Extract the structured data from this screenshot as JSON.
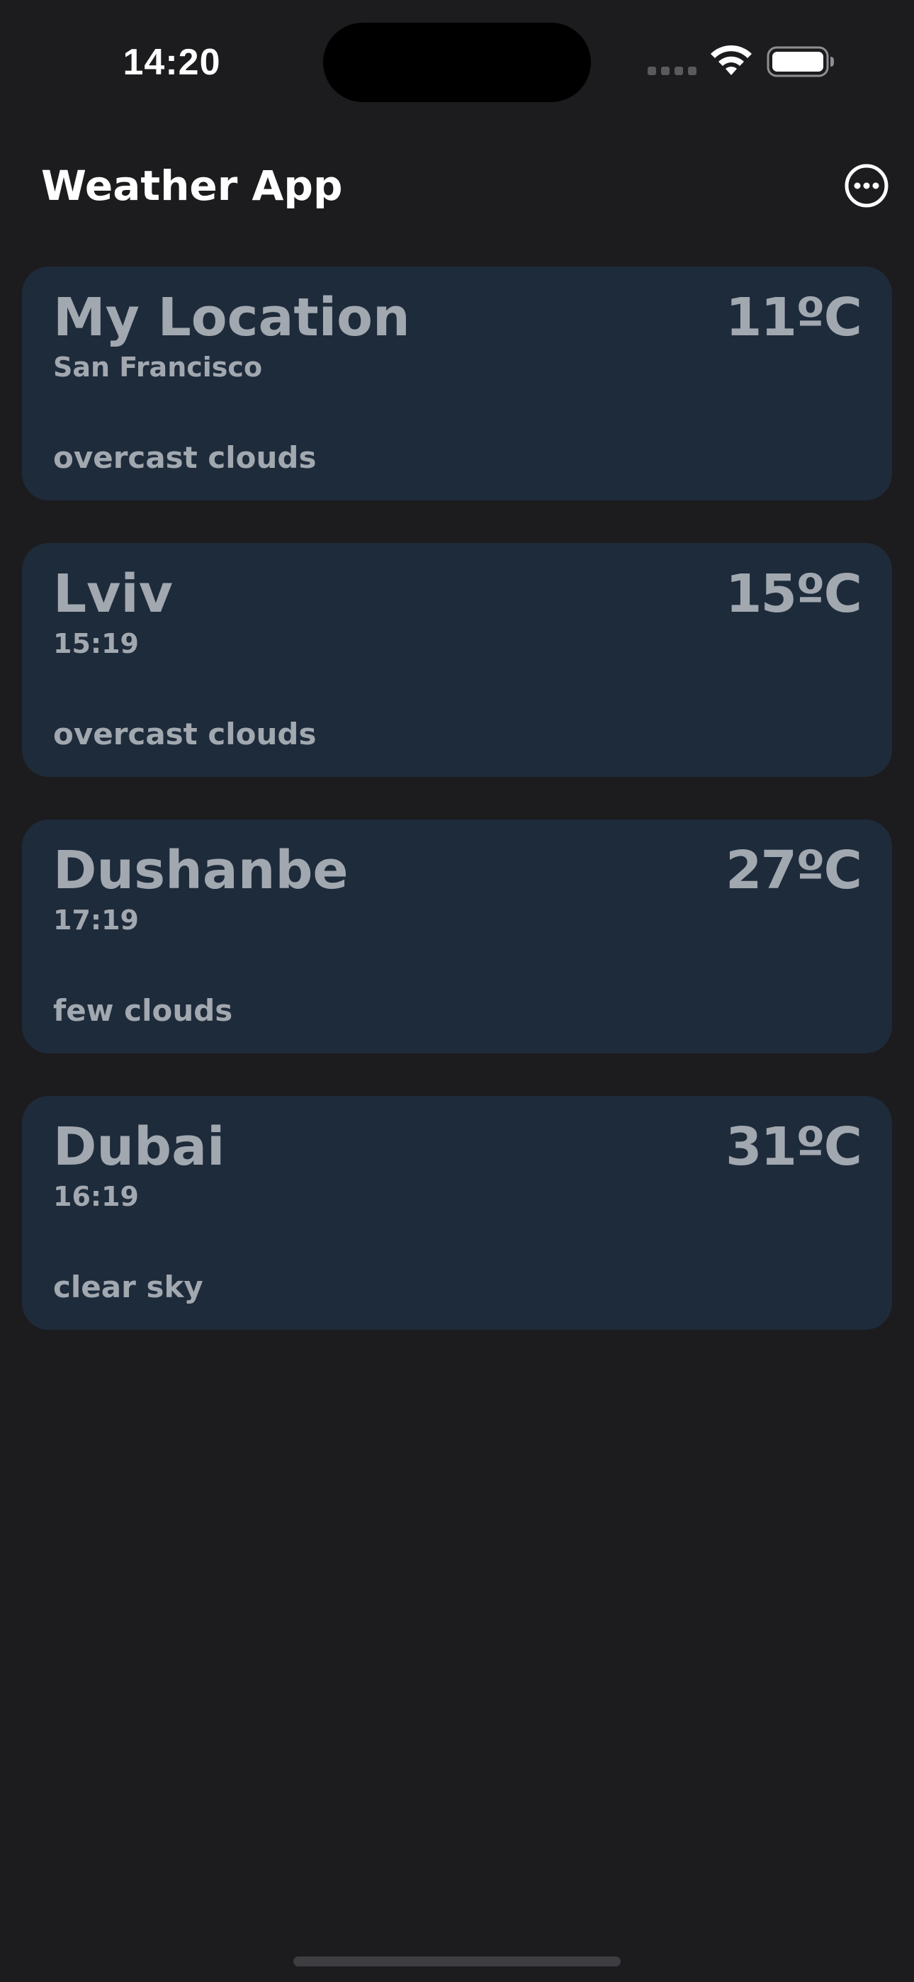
{
  "status_bar": {
    "time": "14:20",
    "icons": [
      "cellular-signal-icon",
      "wifi-icon",
      "battery-icon"
    ]
  },
  "header": {
    "title": "Weather App",
    "more_icon": "ellipsis-circle-icon"
  },
  "locations": [
    {
      "name": "My Location",
      "subtitle": "San Francisco",
      "temperature": "11ºC",
      "description": "overcast clouds"
    },
    {
      "name": "Lviv",
      "subtitle": "15:19",
      "temperature": "15ºC",
      "description": "overcast clouds"
    },
    {
      "name": "Dushanbe",
      "subtitle": "17:19",
      "temperature": "27ºC",
      "description": "few clouds"
    },
    {
      "name": "Dubai",
      "subtitle": "16:19",
      "temperature": "31ºC",
      "description": "clear sky"
    }
  ],
  "colors": {
    "background": "#1c1c1e",
    "card": "#1e2b3b",
    "card_text": "#a2a8b0",
    "title_text": "#ffffff"
  }
}
